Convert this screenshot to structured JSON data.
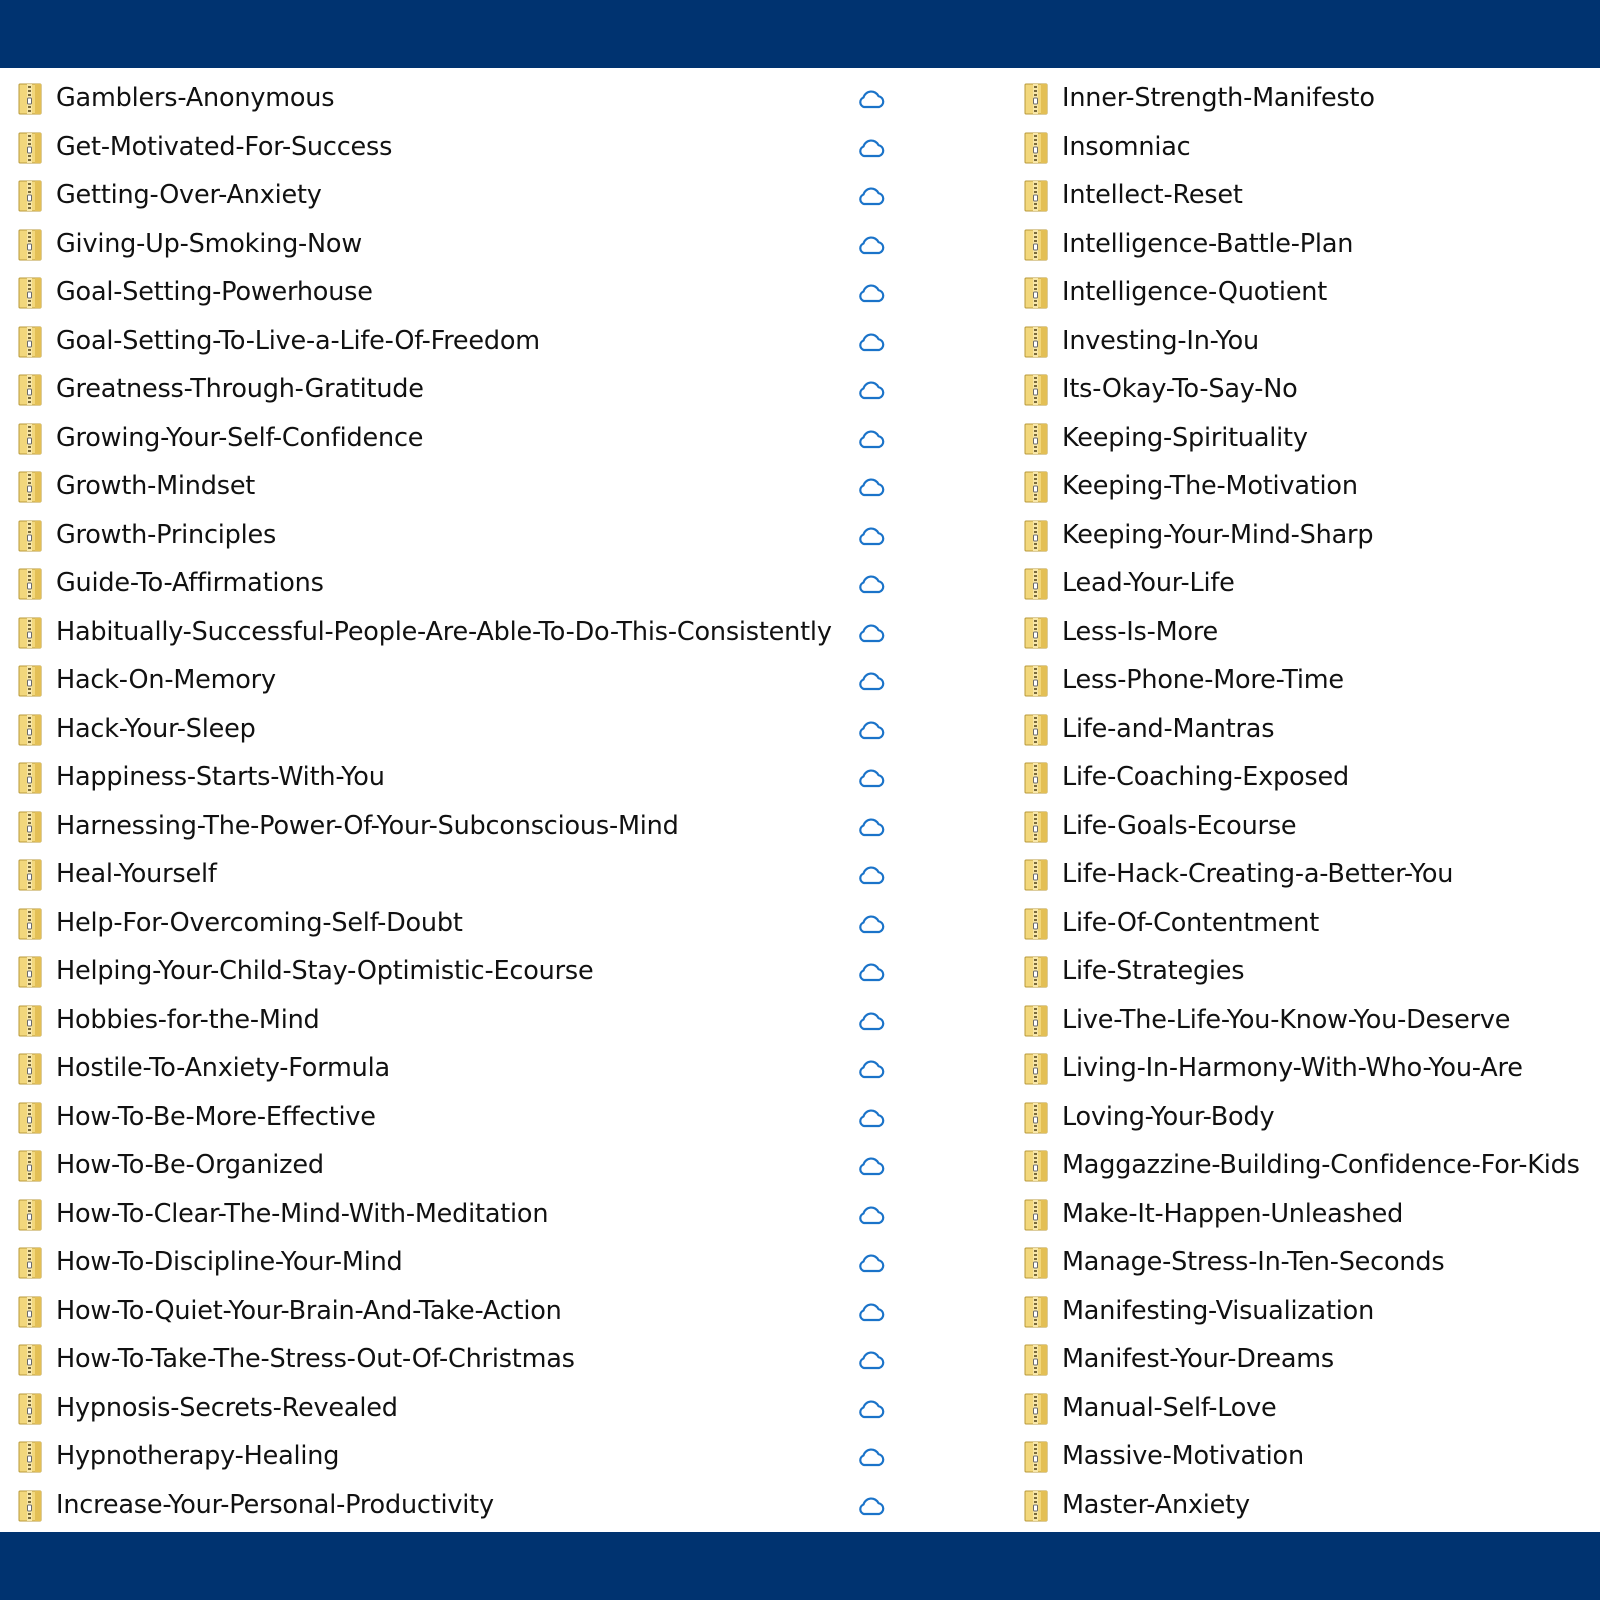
{
  "colors": {
    "band": "#003370",
    "background": "#ffffff",
    "cloud_outline": "#1a73c9",
    "zip_icon": "#e8c75a"
  },
  "icons": {
    "file": "zip-folder-icon",
    "status": "cloud-icon"
  },
  "left_column": [
    "Gamblers-Anonymous",
    "Get-Motivated-For-Success",
    "Getting-Over-Anxiety",
    "Giving-Up-Smoking-Now",
    "Goal-Setting-Powerhouse",
    "Goal-Setting-To-Live-a-Life-Of-Freedom",
    "Greatness-Through-Gratitude",
    "Growing-Your-Self-Confidence",
    "Growth-Mindset",
    "Growth-Principles",
    "Guide-To-Affirmations",
    "Habitually-Successful-People-Are-Able-To-Do-This-Consistently",
    "Hack-On-Memory",
    "Hack-Your-Sleep",
    "Happiness-Starts-With-You",
    "Harnessing-The-Power-Of-Your-Subconscious-Mind",
    "Heal-Yourself",
    "Help-For-Overcoming-Self-Doubt",
    "Helping-Your-Child-Stay-Optimistic-Ecourse",
    "Hobbies-for-the-Mind",
    "Hostile-To-Anxiety-Formula",
    "How-To-Be-More-Effective",
    "How-To-Be-Organized",
    "How-To-Clear-The-Mind-With-Meditation",
    "How-To-Discipline-Your-Mind",
    "How-To-Quiet-Your-Brain-And-Take-Action",
    "How-To-Take-The-Stress-Out-Of-Christmas",
    "Hypnosis-Secrets-Revealed",
    "Hypnotherapy-Healing",
    "Increase-Your-Personal-Productivity"
  ],
  "right_column": [
    "Inner-Strength-Manifesto",
    "Insomniac",
    "Intellect-Reset",
    "Intelligence-Battle-Plan",
    "Intelligence-Quotient",
    "Investing-In-You",
    "Its-Okay-To-Say-No",
    "Keeping-Spirituality",
    "Keeping-The-Motivation",
    "Keeping-Your-Mind-Sharp",
    "Lead-Your-Life",
    "Less-Is-More",
    "Less-Phone-More-Time",
    "Life-and-Mantras",
    "Life-Coaching-Exposed",
    "Life-Goals-Ecourse",
    "Life-Hack-Creating-a-Better-You",
    "Life-Of-Contentment",
    "Life-Strategies",
    "Live-The-Life-You-Know-You-Deserve",
    "Living-In-Harmony-With-Who-You-Are",
    "Loving-Your-Body",
    "Maggazzine-Building-Confidence-For-Kids",
    "Make-It-Happen-Unleashed",
    "Manage-Stress-In-Ten-Seconds",
    "Manifesting-Visualization",
    "Manifest-Your-Dreams",
    "Manual-Self-Love",
    "Massive-Motivation",
    "Master-Anxiety"
  ]
}
